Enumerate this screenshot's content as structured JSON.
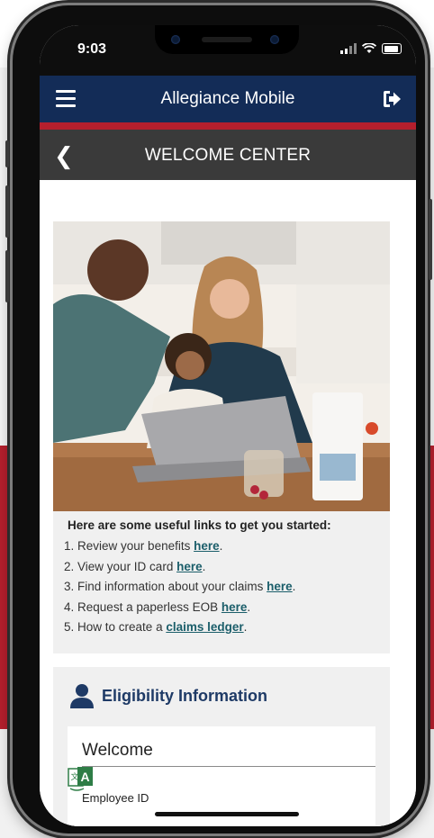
{
  "status_bar": {
    "time": "9:03"
  },
  "app_bar": {
    "title": "Allegiance Mobile"
  },
  "sub_bar": {
    "title": "WELCOME CENTER"
  },
  "links_card": {
    "intro": "Here are some useful links to get you started:",
    "items": [
      {
        "number": "1.",
        "text": "Review your benefits ",
        "link": "here",
        "suffix": "."
      },
      {
        "number": "2.",
        "text": "View your ID card ",
        "link": "here",
        "suffix": "."
      },
      {
        "number": "3.",
        "text": "Find information about your claims ",
        "link": "here",
        "suffix": "."
      },
      {
        "number": "4.",
        "text": "Request a paperless EOB ",
        "link": "here",
        "suffix": "."
      },
      {
        "number": "5.",
        "text": "How to create a ",
        "link": "claims ledger",
        "suffix": "."
      }
    ]
  },
  "eligibility": {
    "title": "Eligibility Information",
    "welcome": "Welcome",
    "employee_id_label": "Employee ID"
  },
  "colors": {
    "navy": "#132c57",
    "red_accent": "#b51f2d",
    "link_teal": "#1b5e6a",
    "heading_blue": "#1e3a66"
  },
  "icons": [
    "menu-icon",
    "logout-icon",
    "back-chevron-icon",
    "person-icon",
    "translate-icon"
  ]
}
